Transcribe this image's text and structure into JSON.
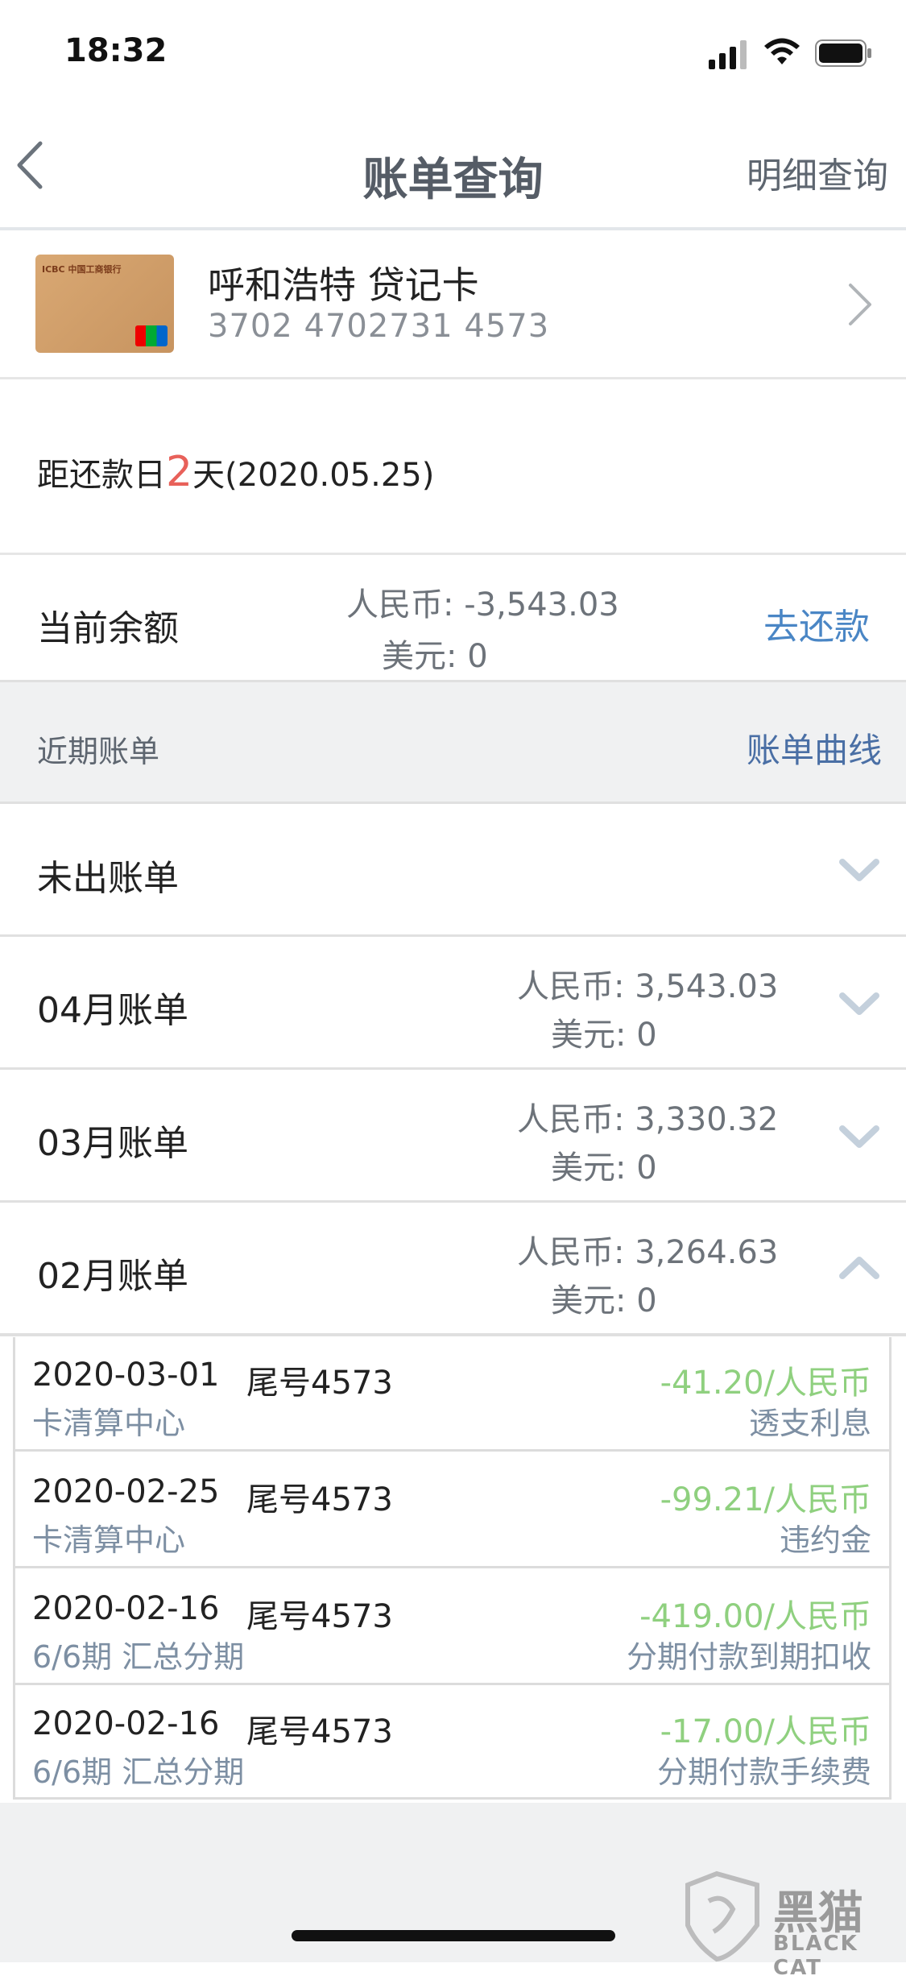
{
  "status": {
    "time": "18:32"
  },
  "nav": {
    "title": "账单查询",
    "right": "明细查询"
  },
  "card": {
    "name": "呼和浩特 贷记卡",
    "number": "3702 4702731 4573",
    "bank_logo_text": "ICBC 中国工商银行"
  },
  "due": {
    "prefix": "距还款日",
    "days": "2",
    "suffix": "天(2020.05.25)"
  },
  "balance": {
    "label": "当前余额",
    "rmb": "人民币: -3,543.03",
    "usd": "美元: 0",
    "pay_label": "去还款"
  },
  "recent": {
    "label": "近期账单",
    "curve_label": "账单曲线"
  },
  "bills": [
    {
      "label": "未出账单",
      "rmb": "",
      "usd": ""
    },
    {
      "label": "04月账单",
      "rmb": "人民币: 3,543.03",
      "usd": "美元: 0"
    },
    {
      "label": "03月账单",
      "rmb": "人民币: 3,330.32",
      "usd": "美元: 0"
    },
    {
      "label": "02月账单",
      "rmb": "人民币: 3,264.63",
      "usd": "美元: 0"
    }
  ],
  "transactions": [
    {
      "date": "2020-03-01",
      "card": "尾号4573",
      "source": "卡清算中心",
      "amount": "-41.20/人民币",
      "type": "透支利息"
    },
    {
      "date": "2020-02-25",
      "card": "尾号4573",
      "source": "卡清算中心",
      "amount": "-99.21/人民币",
      "type": "违约金"
    },
    {
      "date": "2020-02-16",
      "card": "尾号4573",
      "source": "6/6期 汇总分期",
      "amount": "-419.00/人民币",
      "type": "分期付款到期扣收"
    },
    {
      "date": "2020-02-16",
      "card": "尾号4573",
      "source": "6/6期 汇总分期",
      "amount": "-17.00/人民币",
      "type": "分期付款手续费"
    }
  ],
  "watermark": {
    "text": "黑猫",
    "sub": "BLACK CAT"
  },
  "colors": {
    "accent": "#4a86c5",
    "positive": "#8fd07f",
    "due_red": "#e8615a"
  }
}
